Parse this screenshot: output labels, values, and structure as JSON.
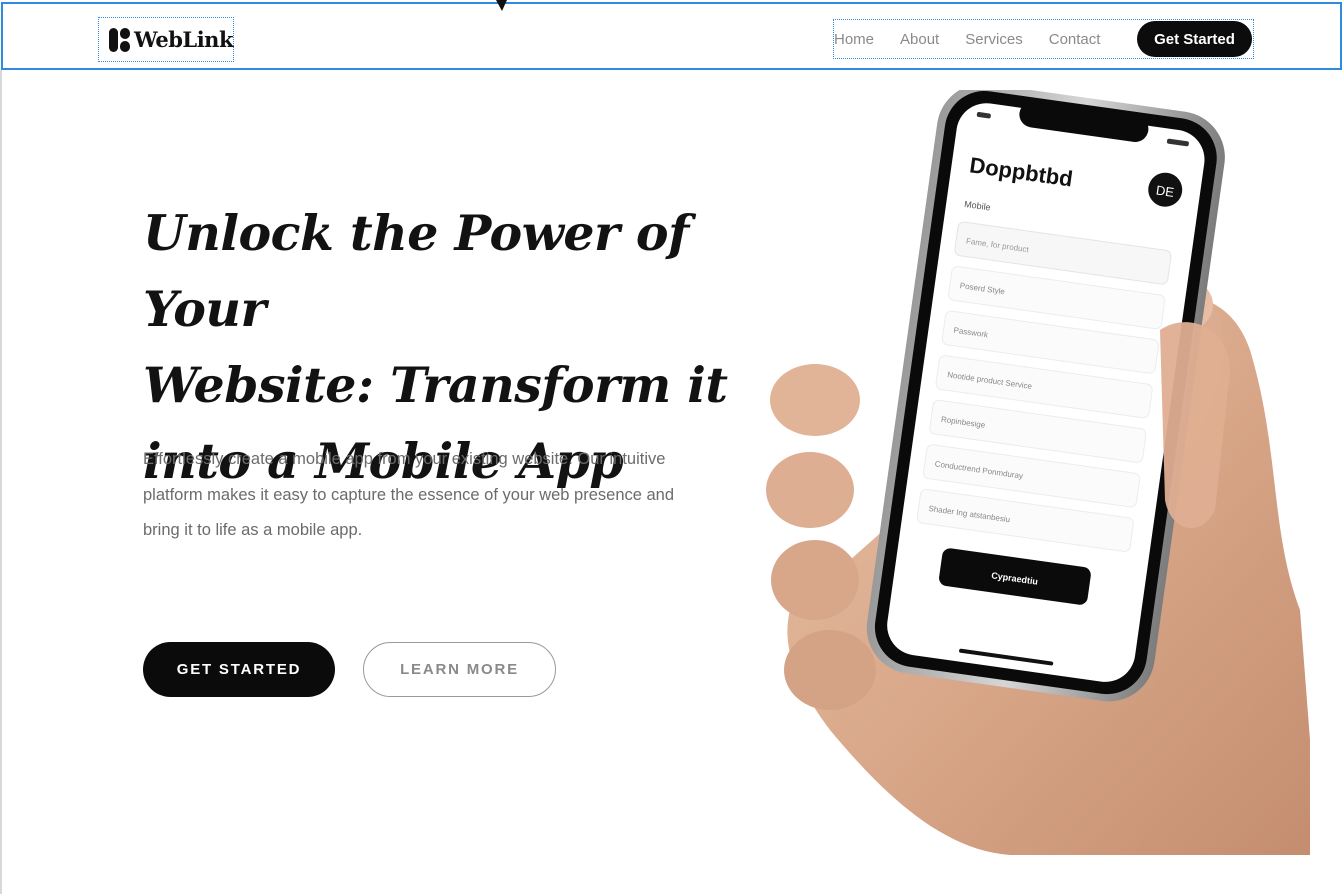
{
  "header": {
    "logo_text": "WebLink",
    "nav": [
      {
        "label": "Home"
      },
      {
        "label": "About"
      },
      {
        "label": "Services"
      },
      {
        "label": "Contact"
      }
    ],
    "cta_label": "Get Started"
  },
  "hero": {
    "title_lines": [
      "Unlock the Power of Your",
      "Website: Transform it",
      "into a Mobile App"
    ],
    "description": "Effortlessly create a mobile app from your existing website. Our intuitive platform makes it easy to capture the essence of your web presence and bring it to life as a mobile app.",
    "primary_button": "GET STARTED",
    "secondary_button": "LEARN MORE"
  },
  "phone_screen": {
    "app_title": "Doppbtbd",
    "avatar": "DE",
    "section_label": "Mobile",
    "fields": [
      "Fame, for product",
      "Poserd Style",
      "Passwork",
      "Nootide product Service",
      "Ropinbesige",
      "Conductrend Ponmduray",
      "Shader Ing atstanbesiu"
    ],
    "button": "Cypraedtiu"
  },
  "colors": {
    "accent_outline": "#2f8be0",
    "primary": "#0b0b0b",
    "muted_text": "#6b6b6b",
    "nav_text": "#8a8a8a"
  }
}
